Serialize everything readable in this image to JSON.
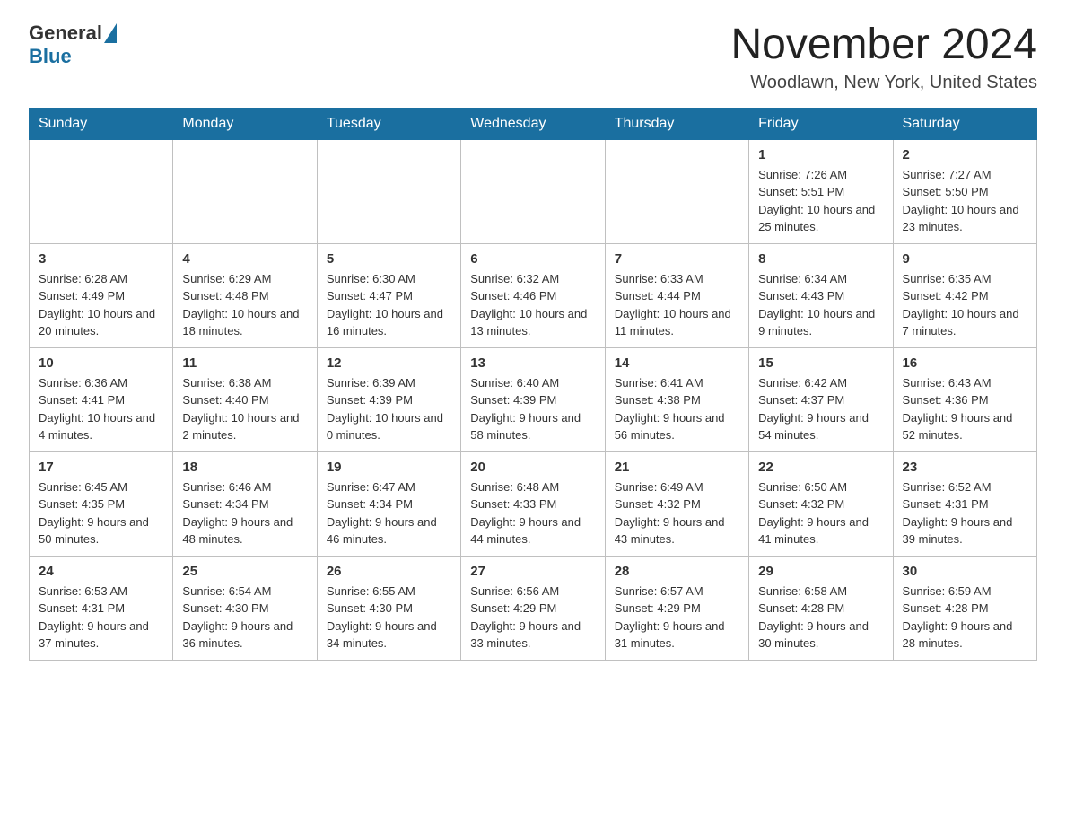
{
  "header": {
    "logo_general": "General",
    "logo_blue": "Blue",
    "month_title": "November 2024",
    "location": "Woodlawn, New York, United States"
  },
  "days_of_week": [
    "Sunday",
    "Monday",
    "Tuesday",
    "Wednesday",
    "Thursday",
    "Friday",
    "Saturday"
  ],
  "weeks": [
    [
      {
        "day": "",
        "info": ""
      },
      {
        "day": "",
        "info": ""
      },
      {
        "day": "",
        "info": ""
      },
      {
        "day": "",
        "info": ""
      },
      {
        "day": "",
        "info": ""
      },
      {
        "day": "1",
        "info": "Sunrise: 7:26 AM\nSunset: 5:51 PM\nDaylight: 10 hours and 25 minutes."
      },
      {
        "day": "2",
        "info": "Sunrise: 7:27 AM\nSunset: 5:50 PM\nDaylight: 10 hours and 23 minutes."
      }
    ],
    [
      {
        "day": "3",
        "info": "Sunrise: 6:28 AM\nSunset: 4:49 PM\nDaylight: 10 hours and 20 minutes."
      },
      {
        "day": "4",
        "info": "Sunrise: 6:29 AM\nSunset: 4:48 PM\nDaylight: 10 hours and 18 minutes."
      },
      {
        "day": "5",
        "info": "Sunrise: 6:30 AM\nSunset: 4:47 PM\nDaylight: 10 hours and 16 minutes."
      },
      {
        "day": "6",
        "info": "Sunrise: 6:32 AM\nSunset: 4:46 PM\nDaylight: 10 hours and 13 minutes."
      },
      {
        "day": "7",
        "info": "Sunrise: 6:33 AM\nSunset: 4:44 PM\nDaylight: 10 hours and 11 minutes."
      },
      {
        "day": "8",
        "info": "Sunrise: 6:34 AM\nSunset: 4:43 PM\nDaylight: 10 hours and 9 minutes."
      },
      {
        "day": "9",
        "info": "Sunrise: 6:35 AM\nSunset: 4:42 PM\nDaylight: 10 hours and 7 minutes."
      }
    ],
    [
      {
        "day": "10",
        "info": "Sunrise: 6:36 AM\nSunset: 4:41 PM\nDaylight: 10 hours and 4 minutes."
      },
      {
        "day": "11",
        "info": "Sunrise: 6:38 AM\nSunset: 4:40 PM\nDaylight: 10 hours and 2 minutes."
      },
      {
        "day": "12",
        "info": "Sunrise: 6:39 AM\nSunset: 4:39 PM\nDaylight: 10 hours and 0 minutes."
      },
      {
        "day": "13",
        "info": "Sunrise: 6:40 AM\nSunset: 4:39 PM\nDaylight: 9 hours and 58 minutes."
      },
      {
        "day": "14",
        "info": "Sunrise: 6:41 AM\nSunset: 4:38 PM\nDaylight: 9 hours and 56 minutes."
      },
      {
        "day": "15",
        "info": "Sunrise: 6:42 AM\nSunset: 4:37 PM\nDaylight: 9 hours and 54 minutes."
      },
      {
        "day": "16",
        "info": "Sunrise: 6:43 AM\nSunset: 4:36 PM\nDaylight: 9 hours and 52 minutes."
      }
    ],
    [
      {
        "day": "17",
        "info": "Sunrise: 6:45 AM\nSunset: 4:35 PM\nDaylight: 9 hours and 50 minutes."
      },
      {
        "day": "18",
        "info": "Sunrise: 6:46 AM\nSunset: 4:34 PM\nDaylight: 9 hours and 48 minutes."
      },
      {
        "day": "19",
        "info": "Sunrise: 6:47 AM\nSunset: 4:34 PM\nDaylight: 9 hours and 46 minutes."
      },
      {
        "day": "20",
        "info": "Sunrise: 6:48 AM\nSunset: 4:33 PM\nDaylight: 9 hours and 44 minutes."
      },
      {
        "day": "21",
        "info": "Sunrise: 6:49 AM\nSunset: 4:32 PM\nDaylight: 9 hours and 43 minutes."
      },
      {
        "day": "22",
        "info": "Sunrise: 6:50 AM\nSunset: 4:32 PM\nDaylight: 9 hours and 41 minutes."
      },
      {
        "day": "23",
        "info": "Sunrise: 6:52 AM\nSunset: 4:31 PM\nDaylight: 9 hours and 39 minutes."
      }
    ],
    [
      {
        "day": "24",
        "info": "Sunrise: 6:53 AM\nSunset: 4:31 PM\nDaylight: 9 hours and 37 minutes."
      },
      {
        "day": "25",
        "info": "Sunrise: 6:54 AM\nSunset: 4:30 PM\nDaylight: 9 hours and 36 minutes."
      },
      {
        "day": "26",
        "info": "Sunrise: 6:55 AM\nSunset: 4:30 PM\nDaylight: 9 hours and 34 minutes."
      },
      {
        "day": "27",
        "info": "Sunrise: 6:56 AM\nSunset: 4:29 PM\nDaylight: 9 hours and 33 minutes."
      },
      {
        "day": "28",
        "info": "Sunrise: 6:57 AM\nSunset: 4:29 PM\nDaylight: 9 hours and 31 minutes."
      },
      {
        "day": "29",
        "info": "Sunrise: 6:58 AM\nSunset: 4:28 PM\nDaylight: 9 hours and 30 minutes."
      },
      {
        "day": "30",
        "info": "Sunrise: 6:59 AM\nSunset: 4:28 PM\nDaylight: 9 hours and 28 minutes."
      }
    ]
  ]
}
